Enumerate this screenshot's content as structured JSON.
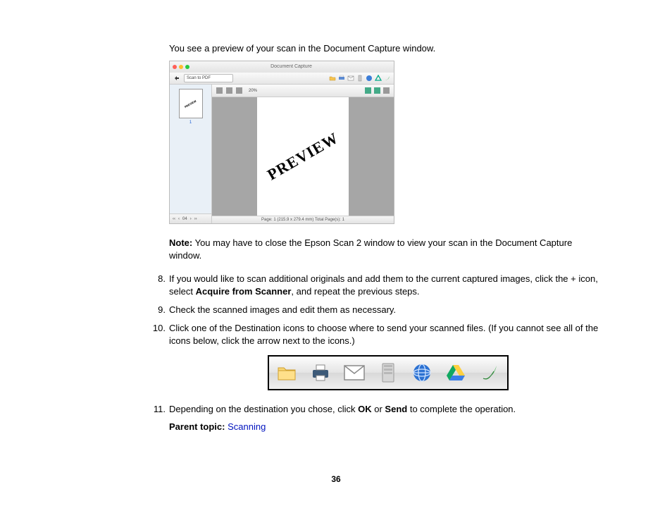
{
  "intro": "You see a preview of your scan in the Document Capture window.",
  "screenshot": {
    "window_title": "Document Capture",
    "dropdown_label": "Scan to PDF",
    "preview_word": "PREVIEW",
    "thumb_label": "PREVIEW",
    "thumb_number": "1",
    "side_nav": "04",
    "status": "Page: 1 (215.9 x 279.4 mm)  Total Page(s): 1",
    "zoom": "20%"
  },
  "note": {
    "label": "Note:",
    "text": " You may have to close the Epson Scan 2 window to view your scan in the Document Capture window."
  },
  "steps": {
    "s8": {
      "num": "8.",
      "t1": "If you would like to scan additional originals and add them to the current captured images, click the + icon, select ",
      "bold": "Acquire from Scanner",
      "t2": ", and repeat the previous steps."
    },
    "s9": {
      "num": "9.",
      "t1": "Check the scanned images and edit them as necessary."
    },
    "s10": {
      "num": "10.",
      "t1": "Click one of the Destination icons to choose where to send your scanned files. (If you cannot see all of the icons below, click the arrow next to the icons.)"
    },
    "s11": {
      "num": "11.",
      "t1": "Depending on the destination you chose, click ",
      "b1": "OK",
      "t2": " or ",
      "b2": "Send",
      "t3": " to complete the operation."
    }
  },
  "parent_topic": {
    "label": "Parent topic:",
    "link": "Scanning"
  },
  "page_number": "36",
  "icons": {
    "scan": "scan-icon",
    "folder": "folder-icon",
    "printer": "printer-icon",
    "mail": "mail-icon",
    "server": "server-icon",
    "web": "web-icon",
    "drive": "drive-icon",
    "evernote": "evernote-icon"
  }
}
